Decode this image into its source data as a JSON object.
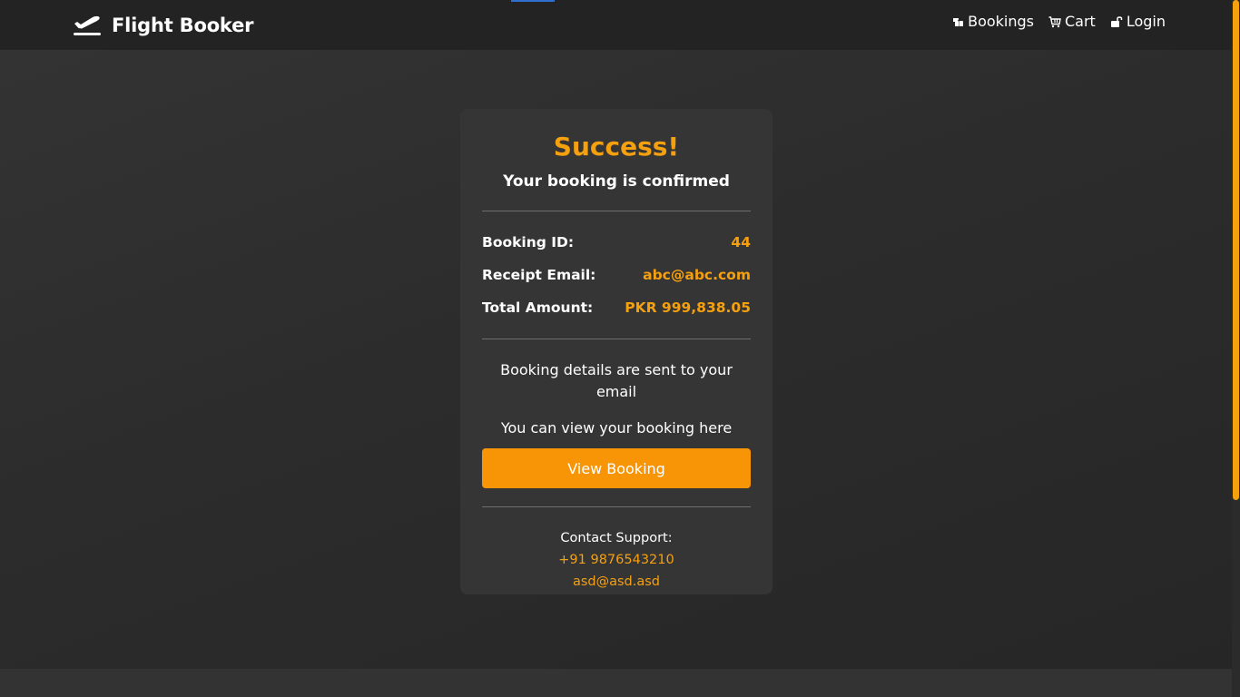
{
  "navbar": {
    "brand": "Flight Booker",
    "links": [
      {
        "label": "Bookings",
        "icon": "ticket-icon"
      },
      {
        "label": "Cart",
        "icon": "cart-icon"
      },
      {
        "label": "Login",
        "icon": "unlock-icon"
      }
    ]
  },
  "card": {
    "title": "Success!",
    "subtitle": "Your booking is confirmed",
    "details": [
      {
        "label": "Booking ID:",
        "value": "44"
      },
      {
        "label": "Receipt Email:",
        "value": "abc@abc.com"
      },
      {
        "label": "Total Amount:",
        "value": "PKR 999,838.05"
      }
    ],
    "info_sent": "Booking details are sent to your email",
    "info_view": "You can view your booking here",
    "view_button": "View Booking",
    "support_label": "Contact Support:",
    "support_phone": "+91 9876543210",
    "support_email": "asd@asd.asd"
  },
  "colors": {
    "accent": "#f5a00f",
    "button": "#f79506",
    "navbar": "#232323",
    "card": "#353535"
  }
}
